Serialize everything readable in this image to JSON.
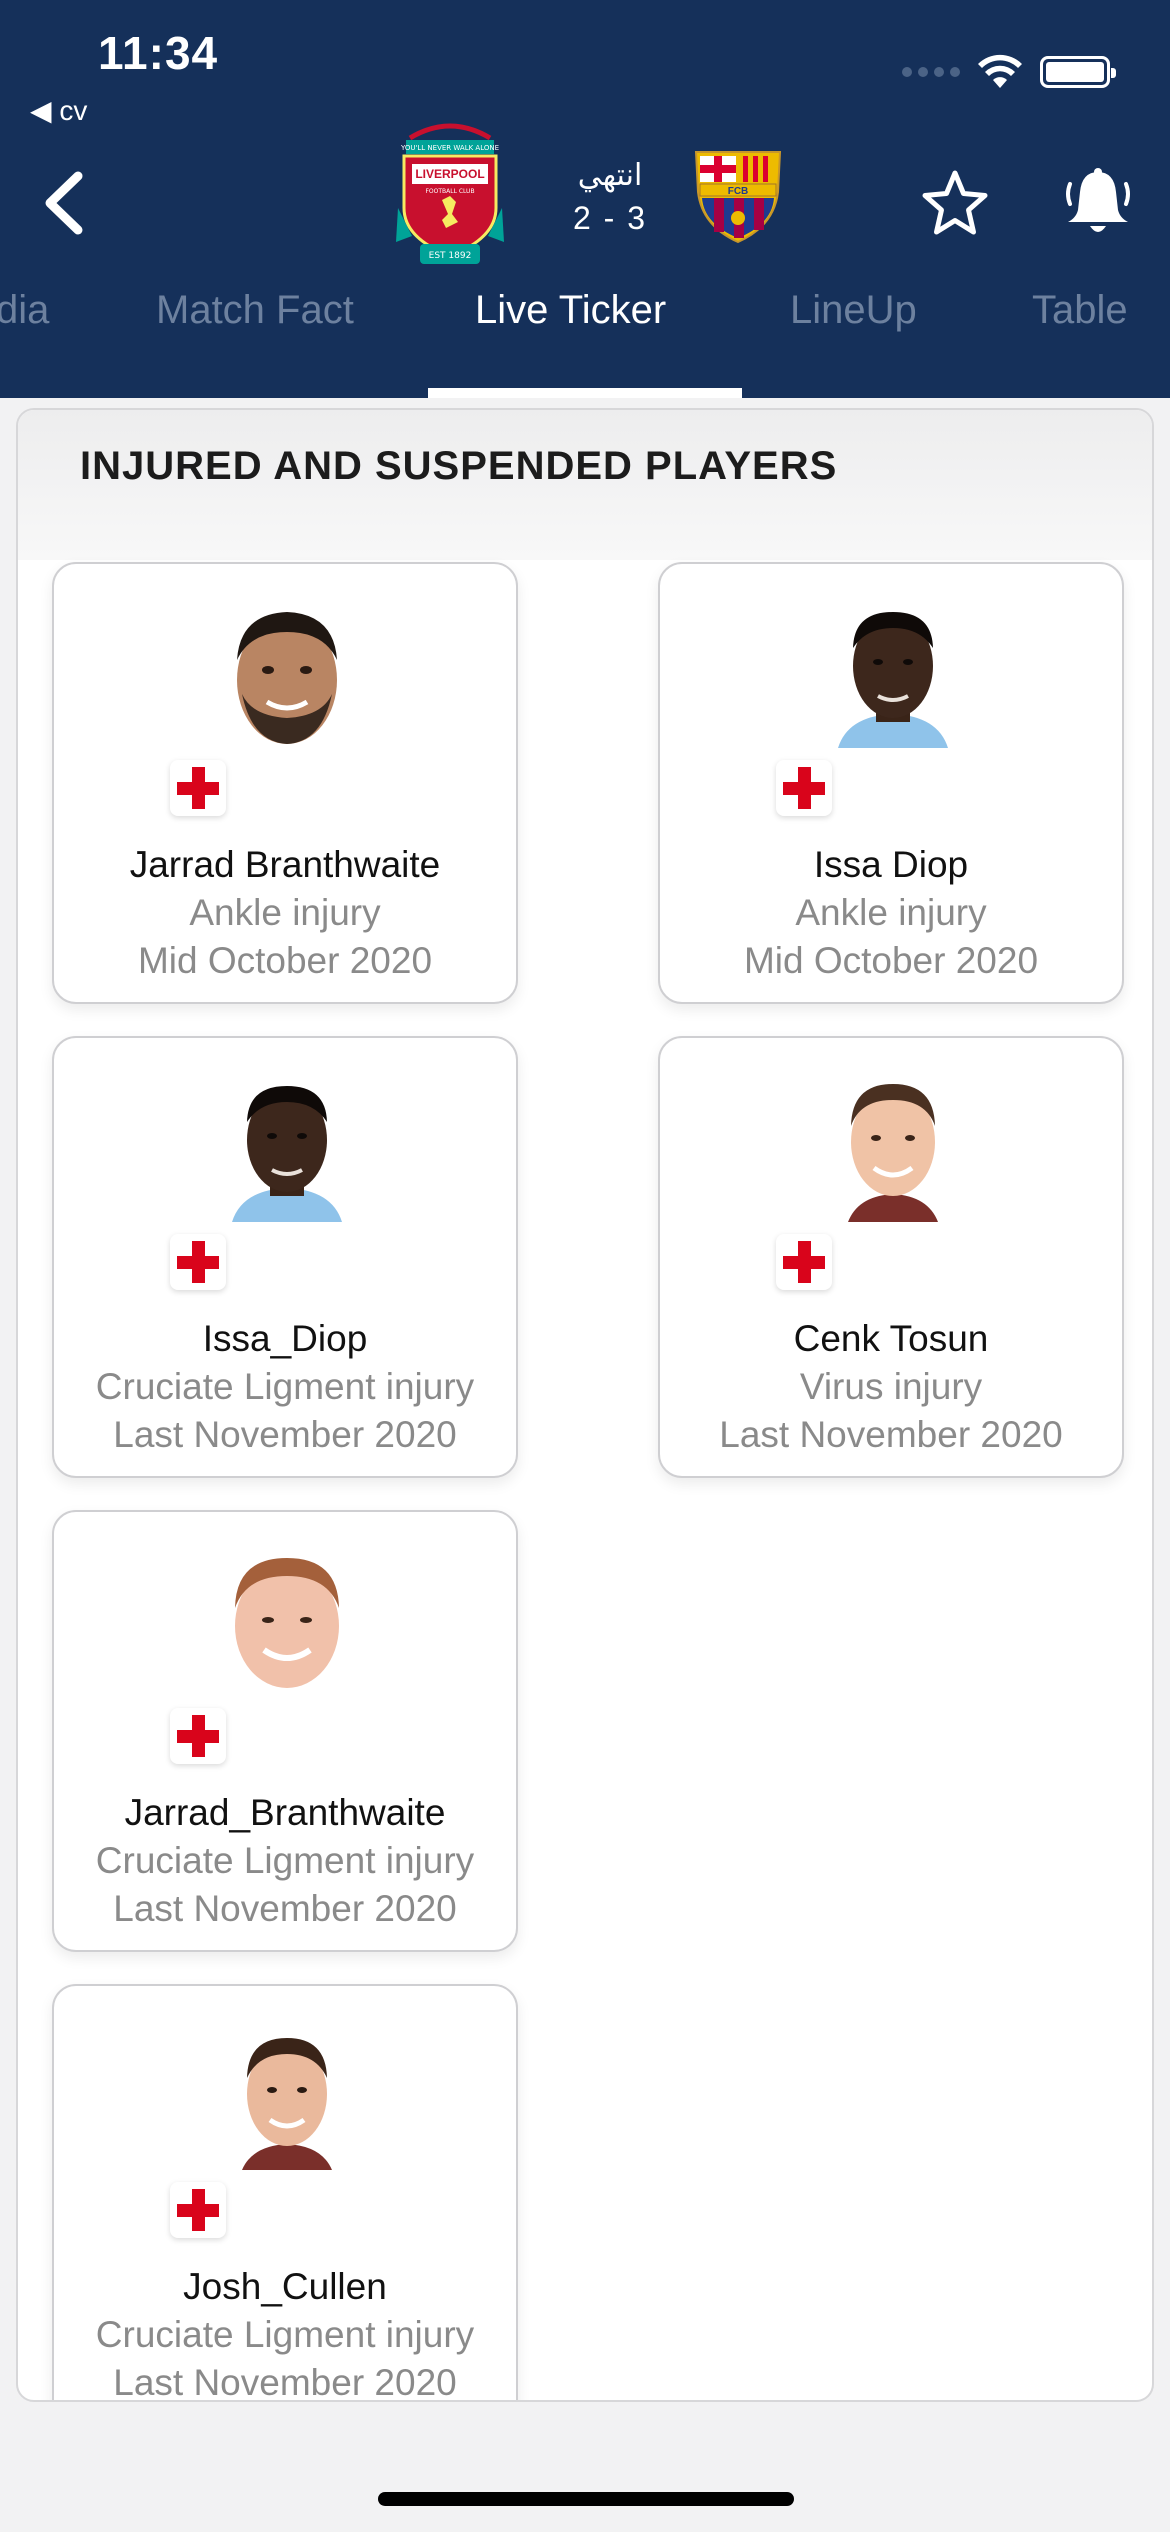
{
  "status_bar": {
    "time": "11:34",
    "back_app": "cv"
  },
  "match": {
    "status": "انتهي",
    "score": "2 - 3"
  },
  "tabs": [
    {
      "label": "dia",
      "active": false
    },
    {
      "label": "Match Fact",
      "active": false
    },
    {
      "label": "Live Ticker",
      "active": true
    },
    {
      "label": "LineUp",
      "active": false
    },
    {
      "label": "Table",
      "active": false
    }
  ],
  "section": {
    "title": "INJURED AND SUSPENDED PLAYERS"
  },
  "players": [
    {
      "name": "Jarrad Branthwaite",
      "reason": "Ankle injury",
      "return": "Mid October 2020"
    },
    {
      "name": "Issa Diop",
      "reason": "Ankle injury",
      "return": "Mid October 2020"
    },
    {
      "name": "Issa_Diop",
      "reason": "Cruciate Ligment injury",
      "return": "Last November 2020"
    },
    {
      "name": "Cenk Tosun",
      "reason": "Virus injury",
      "return": "Last November 2020"
    },
    {
      "name": "Jarrad_Branthwaite",
      "reason": "Cruciate Ligment injury",
      "return": "Last November 2020"
    },
    {
      "name": "Josh_Cullen",
      "reason": "Cruciate Ligment injury",
      "return": "Last November 2020"
    }
  ],
  "logos": {
    "home": {
      "text_top": "LIVERPOOL",
      "text_sub": "FOOTBALL CLUB",
      "text_est": "EST 1892",
      "motto": "YOU'LL NEVER WALK ALONE"
    },
    "away": {
      "text": "FCB"
    }
  },
  "icons": {
    "back": "chevron-left-icon",
    "favorite": "star-outline-icon",
    "notify": "bell-icon",
    "injury": "red-cross-icon"
  },
  "colors": {
    "header": "#15305a",
    "accent_red": "#d9041b"
  }
}
